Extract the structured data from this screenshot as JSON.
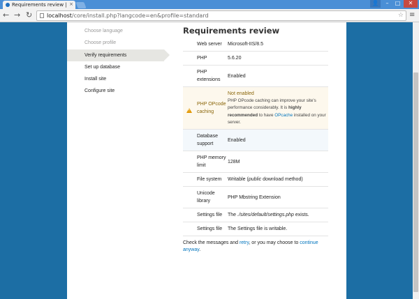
{
  "browser": {
    "tab_title": "Requirements review |",
    "tab_close": "×",
    "url_host": "localhost",
    "url_path": "/core/install.php?langcode=en&profile=standard",
    "back": "←",
    "forward": "→",
    "reload": "↻",
    "star": "☆",
    "menu": "≡",
    "win_user": "👤",
    "win_min": "–",
    "win_max": "□",
    "win_close": "✕"
  },
  "sidebar": {
    "steps": [
      {
        "label": "Choose language",
        "state": "done"
      },
      {
        "label": "Choose profile",
        "state": "done"
      },
      {
        "label": "Verify requirements",
        "state": "active"
      },
      {
        "label": "Set up database",
        "state": "pending"
      },
      {
        "label": "Install site",
        "state": "pending"
      },
      {
        "label": "Configure site",
        "state": "pending"
      }
    ]
  },
  "main": {
    "title": "Requirements review",
    "rows": {
      "web_server": {
        "label": "Web server",
        "value": "Microsoft-IIS/8.5"
      },
      "php": {
        "label": "PHP",
        "value": "5.6.20"
      },
      "php_extensions": {
        "label": "PHP extensions",
        "value": "Enabled"
      },
      "opcode": {
        "label": "PHP OPcode caching",
        "value": "Not enabled",
        "desc_1": "PHP OPcode caching can improve your site's performance considerably. It is ",
        "desc_bold": "highly recommended",
        "desc_2": " to have ",
        "desc_link": "OPcache",
        "desc_3": " installed on your server."
      },
      "database": {
        "label": "Database support",
        "value": "Enabled"
      },
      "memory": {
        "label": "PHP memory limit",
        "value": "128M"
      },
      "file_system": {
        "label": "File system",
        "value_1": "Writable (",
        "value_em": "public",
        "value_2": " download method)"
      },
      "unicode": {
        "label": "Unicode library",
        "value": "PHP Mbstring Extension"
      },
      "settings_exists": {
        "label": "Settings file",
        "value_1": "The ",
        "value_em": "./sites/default/settings.php",
        "value_2": " exists."
      },
      "settings_writable": {
        "label": "Settings file",
        "value": "The Settings file is writable."
      }
    },
    "footer": {
      "text_1": "Check the messages and ",
      "retry_link": "retry",
      "text_2": ", or you may choose to ",
      "continue_link": "continue anyway",
      "text_3": "."
    }
  },
  "colors": {
    "background": "#1c6ea4",
    "warning": "#e29700",
    "link": "#0074bd"
  }
}
